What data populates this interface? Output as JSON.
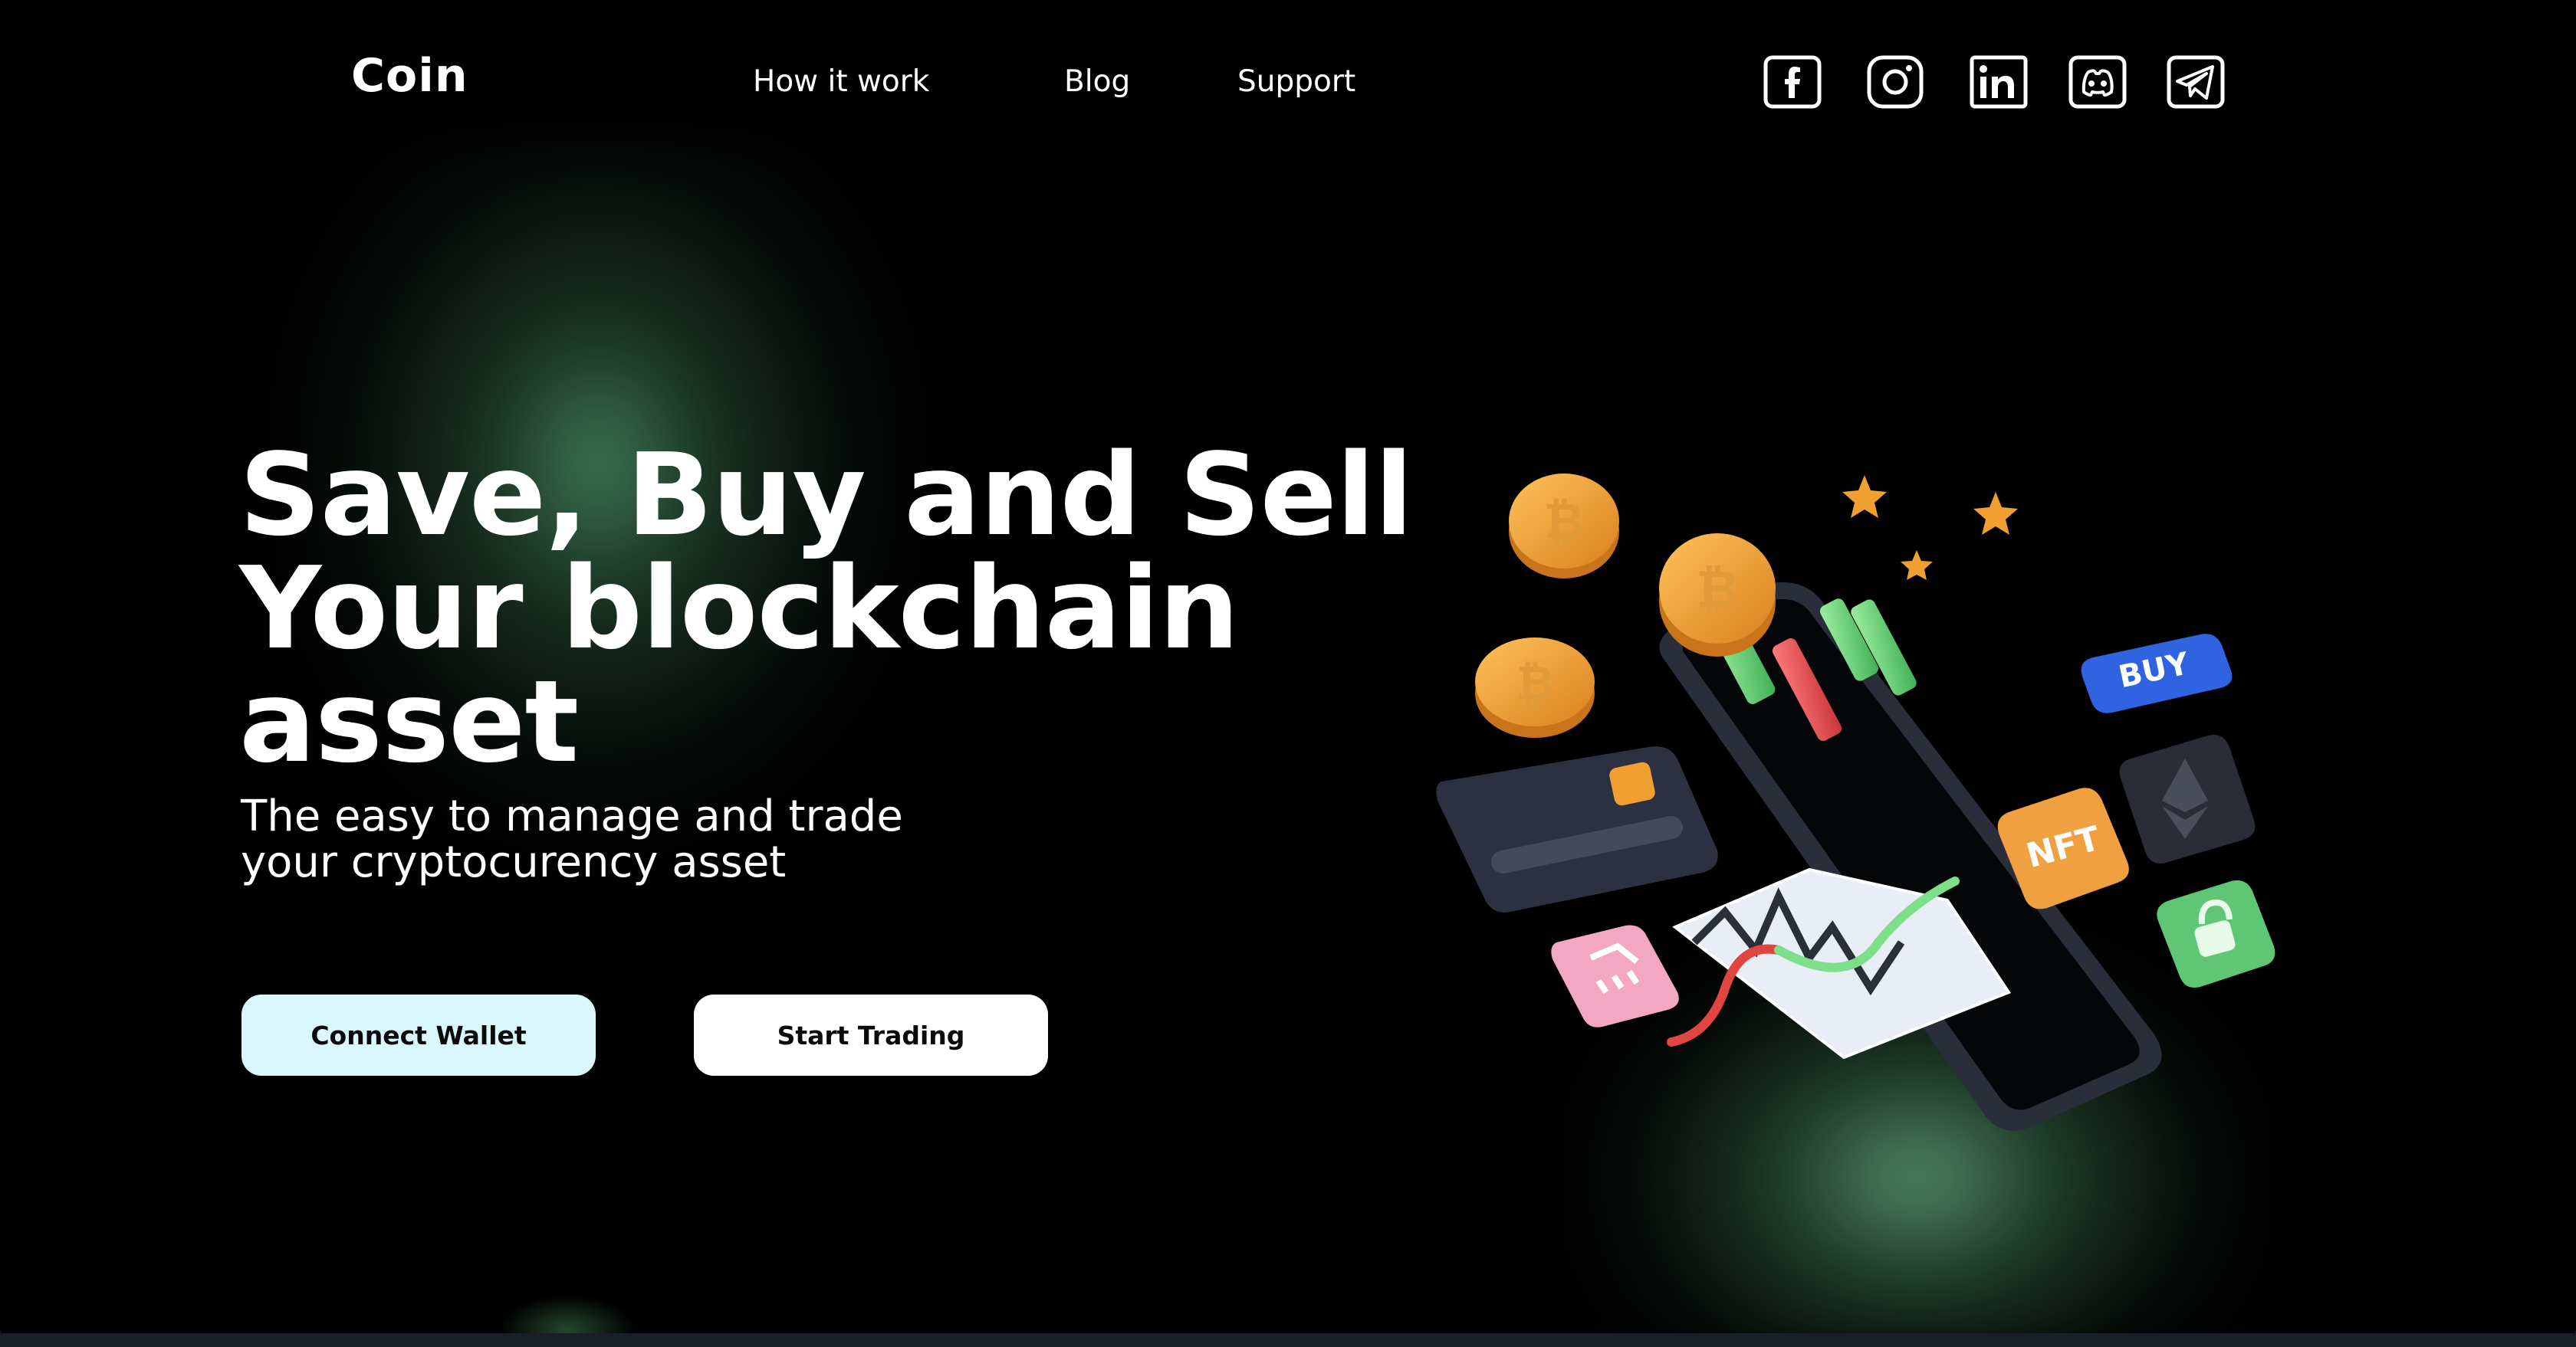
{
  "header": {
    "logo": "Coin",
    "nav": [
      {
        "label": "How it work"
      },
      {
        "label": "Blog"
      },
      {
        "label": "Support"
      }
    ],
    "social_icons": [
      "facebook-icon",
      "instagram-icon",
      "linkedin-icon",
      "discord-icon",
      "telegram-icon"
    ]
  },
  "hero": {
    "headline_lines": [
      "Save, Buy and Sell",
      "Your blockchain",
      "asset"
    ],
    "subtitle_lines": [
      "The easy to manage and trade",
      "your cryptocurency asset"
    ],
    "buttons": {
      "connect_wallet": "Connect Wallet",
      "start_trading": "Start Trading"
    }
  },
  "illustration": {
    "buy_tile": "BUY",
    "nft_tile": "NFT"
  },
  "colors": {
    "background": "#000000",
    "glow_green": "#4a8c60",
    "connect_button_bg": "#d9f7fc",
    "start_button_bg": "#ffffff",
    "buy_tile": "#2f63e0",
    "nft_tile": "#f0a040",
    "coin": "#f0a030"
  }
}
